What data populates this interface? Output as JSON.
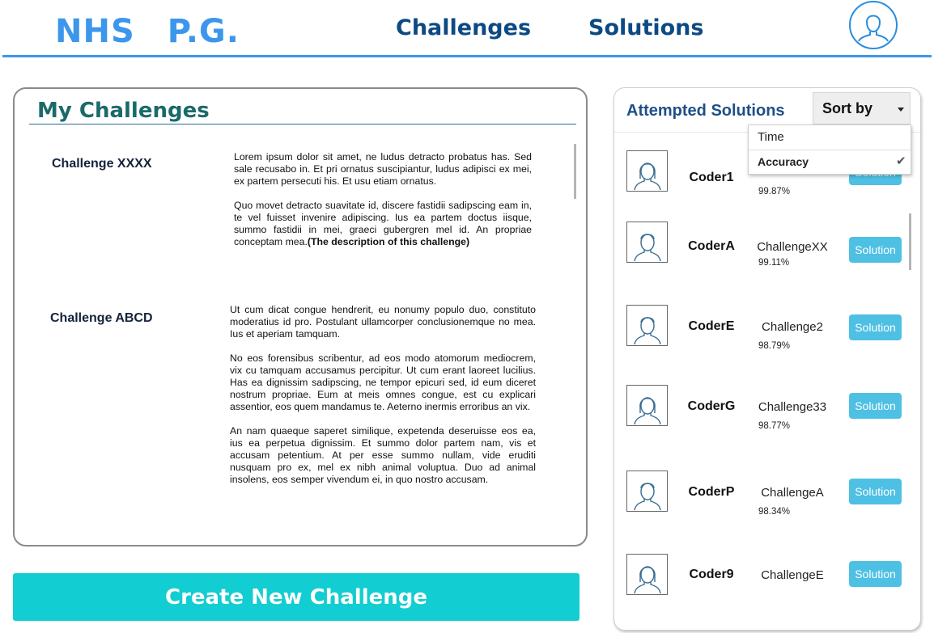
{
  "header": {
    "logo_part1": "NHS",
    "logo_part2": "P.G.",
    "nav": [
      "Challenges",
      "Solutions"
    ],
    "profile_icon": "user-icon"
  },
  "my_challenges": {
    "title": "My Challenges",
    "items": [
      {
        "name": "Challenge XXXX",
        "paragraphs": [
          "Lorem ipsum dolor sit amet, ne ludus detracto probatus has. Sed sale recusabo in. Et pri ornatus suscipiantur, ludus adipisci ex mei, ex partem persecuti his. Et usu etiam ornatus.",
          "Quo movet detracto suavitate id, discere fastidii sadipscing eam in, te vel fuisset invenire adipiscing. Ius ea partem doctus iisque, summo fastidii in mei, graeci gubergren mel id. An propriae conceptam mea."
        ],
        "note": "(The description of this challenge)"
      },
      {
        "name": "Challenge ABCD",
        "paragraphs": [
          "Ut cum dicat congue hendrerit, eu nonumy populo duo, constituto moderatius id pro. Postulant ullamcorper conclusionemque no mea. Ius et aperiam tamquam.",
          "No eos forensibus scribentur, ad eos modo atomorum mediocrem, vix cu tamquam accusamus percipitur. Ut cum erant laoreet lucilius. Has ea dignissim sadipscing, ne tempor epicuri sed, id eum diceret nostrum propriae. Eum at meis omnes congue, est cu explicari assentior, eos quem mandamus te. Aeterno inermis erroribus an vix.",
          "An nam quaeque saperet similique, expetenda deseruisse eos ea, ius ea perpetua dignissim. Et summo dolor partem nam, vis et accusam petentium. At per esse summo nullam, vide eruditi nusquam pro ex, mel ex nibh animal voluptua. Duo ad animal insolens, eos semper vivendum ei, in quo nostro accusam."
        ]
      }
    ]
  },
  "create_button_label": "Create New Challenge",
  "attempted_solutions": {
    "title": "Attempted Solutions",
    "sort": {
      "label": "Sort by",
      "options": [
        "Time",
        "Accuracy"
      ],
      "selected": "Accuracy"
    },
    "solution_button_label": "Solution",
    "rows": [
      {
        "coder": "Coder1",
        "challenge": "",
        "accuracy": "99.87%",
        "avatar": "female"
      },
      {
        "coder": "CoderA",
        "challenge": "ChallengeXX",
        "accuracy": "99.11%",
        "avatar": "male"
      },
      {
        "coder": "CoderE",
        "challenge": "Challenge2",
        "accuracy": "98.79%",
        "avatar": "male"
      },
      {
        "coder": "CoderG",
        "challenge": "Challenge33",
        "accuracy": "98.77%",
        "avatar": "female"
      },
      {
        "coder": "CoderP",
        "challenge": "ChallengeA",
        "accuracy": "98.34%",
        "avatar": "male"
      },
      {
        "coder": "Coder9",
        "challenge": "ChallengeE",
        "accuracy": "",
        "avatar": "female"
      }
    ]
  },
  "colors": {
    "logo": "#3c97ec",
    "nav": "#0d4a84",
    "panel_title": "#1b6a6a",
    "create_button": "#12cdd1",
    "solution_button": "#4ec0e4"
  }
}
